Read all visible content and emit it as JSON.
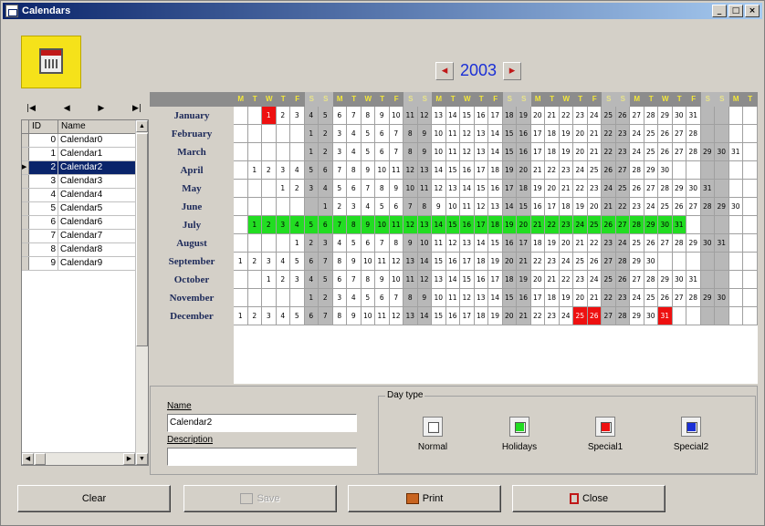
{
  "window": {
    "title": "Calendars",
    "min": "_",
    "max": "□",
    "close": "×"
  },
  "year": "2003",
  "nav": {
    "prev_year": "◂",
    "next_year": "▸"
  },
  "db_nav": [
    "|◀",
    "◀",
    "▶",
    "▶|"
  ],
  "grid": {
    "columns": [
      "ID",
      "Name"
    ],
    "rows": [
      {
        "id": "0",
        "name": "Calendar0"
      },
      {
        "id": "1",
        "name": "Calendar1"
      },
      {
        "id": "2",
        "name": "Calendar2"
      },
      {
        "id": "3",
        "name": "Calendar3"
      },
      {
        "id": "4",
        "name": "Calendar4"
      },
      {
        "id": "5",
        "name": "Calendar5"
      },
      {
        "id": "6",
        "name": "Calendar6"
      },
      {
        "id": "7",
        "name": "Calendar7"
      },
      {
        "id": "8",
        "name": "Calendar8"
      },
      {
        "id": "9",
        "name": "Calendar9"
      }
    ],
    "selected_index": 2
  },
  "weekday_letters": [
    "M",
    "T",
    "W",
    "T",
    "F",
    "S",
    "S"
  ],
  "months": [
    {
      "name": "January",
      "start": 2,
      "days": 31,
      "holiday_days": [],
      "special1_days": [
        1
      ]
    },
    {
      "name": "February",
      "start": 5,
      "days": 28,
      "holiday_days": [],
      "special1_days": []
    },
    {
      "name": "March",
      "start": 5,
      "days": 31,
      "holiday_days": [],
      "special1_days": []
    },
    {
      "name": "April",
      "start": 1,
      "days": 30,
      "holiday_days": [],
      "special1_days": []
    },
    {
      "name": "May",
      "start": 3,
      "days": 31,
      "holiday_days": [],
      "special1_days": []
    },
    {
      "name": "June",
      "start": 6,
      "days": 30,
      "holiday_days": [],
      "special1_days": []
    },
    {
      "name": "July",
      "start": 1,
      "days": 31,
      "holiday_days": [
        1,
        2,
        3,
        4,
        5,
        6,
        7,
        8,
        9,
        10,
        11,
        12,
        13,
        14,
        15,
        16,
        17,
        18,
        19,
        20,
        21,
        22,
        23,
        24,
        25,
        26,
        27,
        28,
        29,
        30,
        31
      ],
      "special1_days": []
    },
    {
      "name": "August",
      "start": 4,
      "days": 31,
      "holiday_days": [],
      "special1_days": []
    },
    {
      "name": "September",
      "start": 0,
      "days": 30,
      "holiday_days": [],
      "special1_days": []
    },
    {
      "name": "October",
      "start": 2,
      "days": 31,
      "holiday_days": [],
      "special1_days": []
    },
    {
      "name": "November",
      "start": 5,
      "days": 30,
      "holiday_days": [],
      "special1_days": []
    },
    {
      "name": "December",
      "start": 0,
      "days": 31,
      "holiday_days": [],
      "special1_days": [
        25,
        26,
        31
      ]
    }
  ],
  "form": {
    "name_label": "Name",
    "name_value": "Calendar2",
    "description_label": "Description",
    "description_value": ""
  },
  "day_type": {
    "title": "Day type",
    "types": [
      {
        "label": "Normal",
        "color": "#ffffff"
      },
      {
        "label": "Holidays",
        "color": "#22dd22"
      },
      {
        "label": "Special1",
        "color": "#ee1010"
      },
      {
        "label": "Special2",
        "color": "#1a2fd6"
      }
    ]
  },
  "buttons": {
    "clear": "Clear",
    "save": "Save",
    "print": "Print",
    "close": "Close"
  },
  "colors": {
    "weekday_header": "#f4e83a",
    "weekend": "#b8b8b8",
    "holiday": "#22dd22",
    "special1": "#ee1010",
    "year": "#1a2fd6"
  }
}
